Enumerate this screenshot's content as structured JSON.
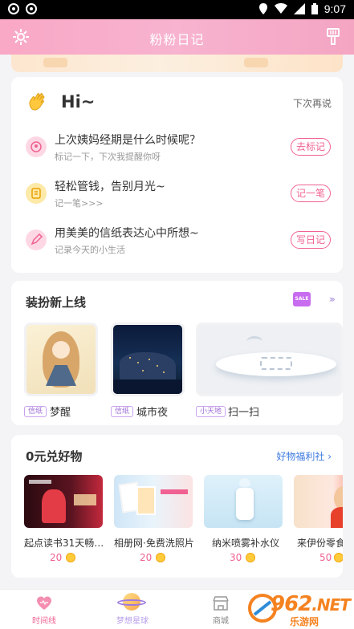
{
  "status_bar": {
    "time": "9:07"
  },
  "header": {
    "title": "粉粉日记",
    "left_icon": "settings-icon",
    "right_icon": "brush-icon"
  },
  "hi_card": {
    "greeting": "Hi~",
    "later": "下次再说",
    "tasks": [
      {
        "title": "上次姨妈经期是什么时候呢？",
        "subtitle": "标记一下，下次我提醒你呀",
        "button": "去标记",
        "icon": "period-icon"
      },
      {
        "title": "轻松管钱，告别月光~",
        "subtitle": "记一笔>>>",
        "button": "记一笔",
        "icon": "money-icon"
      },
      {
        "title": "用美美的信纸表达心中所想~",
        "subtitle": "记录今天的小生活",
        "button": "写日记",
        "icon": "pen-icon"
      }
    ]
  },
  "dress_up": {
    "title": "装扮新上线",
    "sale_badge": "SALE",
    "items": [
      {
        "tag": "信纸",
        "name": "梦醒"
      },
      {
        "tag": "信纸",
        "name": "城市夜"
      },
      {
        "tag": "小天地",
        "name": "扫一扫"
      }
    ]
  },
  "gifts": {
    "title": "0元兑好物",
    "more": "好物福利社",
    "items": [
      {
        "name": "起点读书31天畅…",
        "price": "20"
      },
      {
        "name": "相册网·免费洗照片",
        "price": "20"
      },
      {
        "name": "纳米喷雾补水仪",
        "price": "30"
      },
      {
        "name": "来伊份零食",
        "price": "50"
      }
    ]
  },
  "bottom_nav": [
    {
      "label": "时间线",
      "active": true
    },
    {
      "label": "梦想星球",
      "active": false
    },
    {
      "label": "商城",
      "active": false
    }
  ],
  "watermark": {
    "number": "962",
    "tld": ".NET",
    "site": "乐游网"
  },
  "colors": {
    "accent": "#f06292",
    "header": "#f7b3cf",
    "link": "#3d7be0"
  }
}
